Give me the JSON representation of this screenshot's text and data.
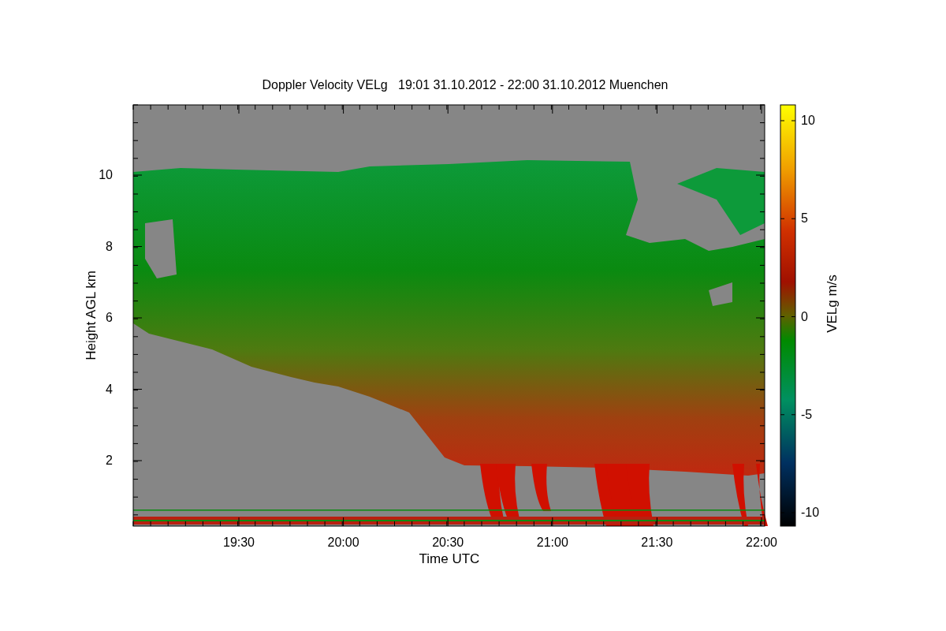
{
  "title": "Doppler Velocity VELg   19:01 31.10.2012 - 22:00 31.10.2012 Muenchen",
  "xlabel": "Time UTC",
  "ylabel": "Height AGL km",
  "x_ticks": [
    "19:30",
    "20:00",
    "20:30",
    "21:00",
    "21:30",
    "22:00"
  ],
  "y_ticks": [
    "10",
    "8",
    "6",
    "4",
    "2"
  ],
  "colorbar": {
    "label": "VELg m/s",
    "ticks": [
      "10",
      "5",
      "0",
      "-5",
      "-10"
    ]
  }
}
